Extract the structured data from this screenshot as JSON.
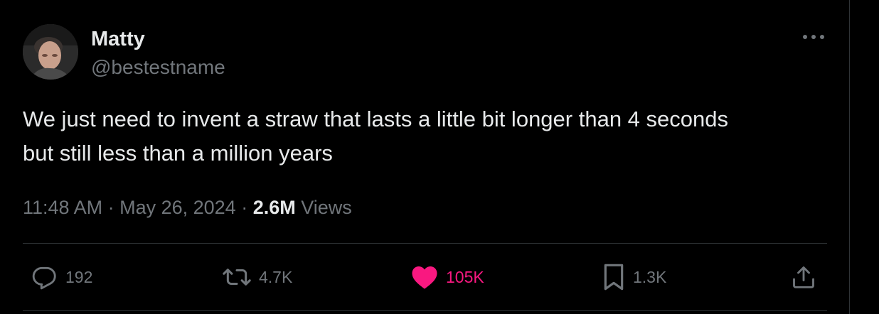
{
  "author": {
    "display_name": "Matty",
    "handle": "@bestestname"
  },
  "tweet": {
    "text": "We just need to invent a straw that lasts a little bit longer than 4 seconds\nbut still less than a million years"
  },
  "meta": {
    "time": "11:48 AM",
    "separator_1": " · ",
    "date": "May 26, 2024",
    "separator_2": " · ",
    "views_count": "2.6M",
    "views_label": " Views"
  },
  "actions": {
    "replies": "192",
    "reposts": "4.7K",
    "likes": "105K",
    "bookmarks": "1.3K"
  },
  "icons": {
    "reply": "reply-icon",
    "repost": "repost-icon",
    "like": "heart-filled-icon",
    "bookmark": "bookmark-icon",
    "share": "share-icon",
    "more": "more-horizontal-icon"
  },
  "colors": {
    "background": "#000000",
    "text_primary": "#e7e9ea",
    "text_secondary": "#71767b",
    "like_active": "#f91880",
    "border": "#2f3336"
  }
}
